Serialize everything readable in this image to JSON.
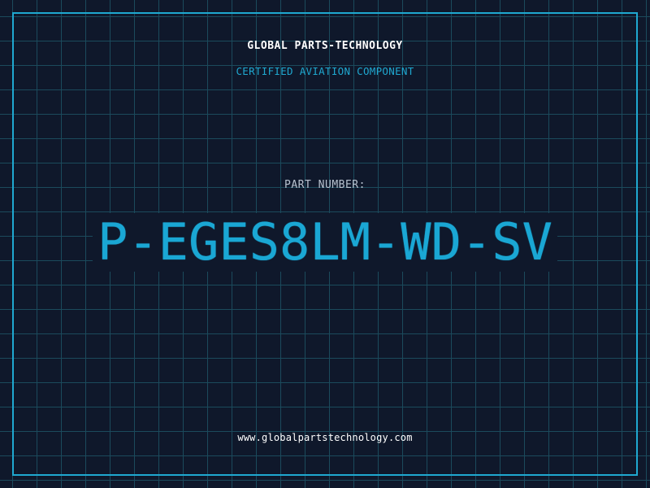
{
  "header": {
    "company": "GLOBAL PARTS-TECHNOLOGY",
    "tagline": "CERTIFIED AVIATION COMPONENT"
  },
  "part": {
    "label": "PART NUMBER:",
    "number": "P-EGES8LM-WD-SV"
  },
  "footer": {
    "url": "www.globalpartstechnology.com"
  },
  "colors": {
    "background": "#0f182b",
    "grid": "#1b4a5c",
    "accent": "#1fa8d0",
    "text": "#ffffff",
    "muted": "#b8c2cf"
  }
}
